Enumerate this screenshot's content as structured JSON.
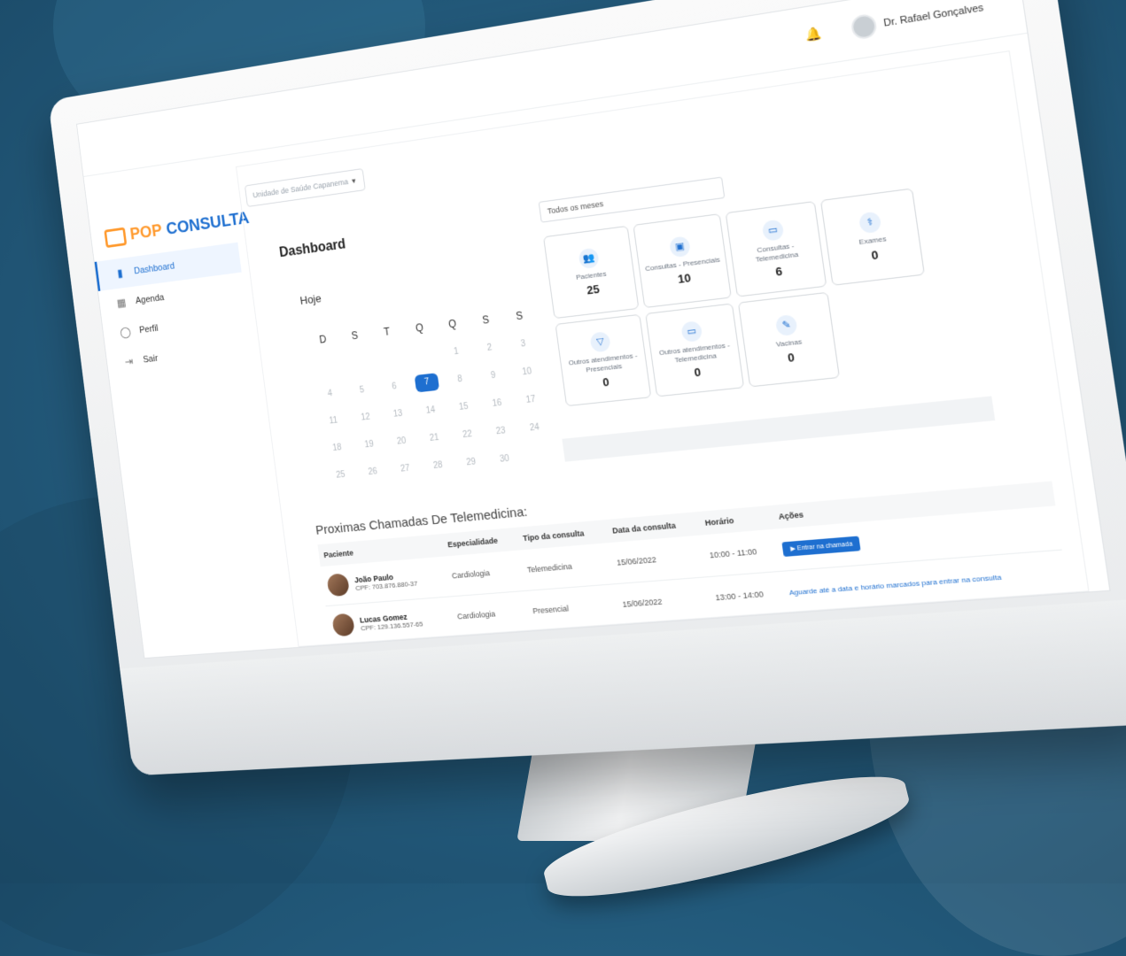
{
  "topbar": {
    "unit_placeholder": "Unidade de Saúde Capanema",
    "user_name": "Dr. Rafael Gonçalves"
  },
  "brand": {
    "pop": "POP",
    "consulta": "CONSULTA"
  },
  "sidebar": {
    "items": [
      {
        "label": "Dashboard",
        "icon": "bar-chart-icon",
        "active": true
      },
      {
        "label": "Agenda",
        "icon": "calendar-icon",
        "active": false
      },
      {
        "label": "Perfil",
        "icon": "user-icon",
        "active": false
      },
      {
        "label": "Sair",
        "icon": "logout-icon",
        "active": false
      }
    ]
  },
  "main": {
    "title": "Dashboard",
    "today_label": "Hoje",
    "month_select": "Todos os meses"
  },
  "calendar": {
    "headers": [
      "D",
      "S",
      "T",
      "Q",
      "Q",
      "S",
      "S"
    ],
    "weeks": [
      [
        "",
        "",
        "",
        "",
        "1",
        "2",
        "3"
      ],
      [
        "4",
        "5",
        "6",
        "7",
        "8",
        "9",
        "10"
      ],
      [
        "11",
        "12",
        "13",
        "14",
        "15",
        "16",
        "17"
      ],
      [
        "18",
        "19",
        "20",
        "21",
        "22",
        "23",
        "24"
      ],
      [
        "25",
        "26",
        "27",
        "28",
        "29",
        "30",
        ""
      ]
    ],
    "selected": "7"
  },
  "stats": [
    {
      "label": "Pacientes",
      "value": "25",
      "icon": "users-icon"
    },
    {
      "label": "Consultas - Presenciais",
      "value": "10",
      "icon": "clipboard-icon"
    },
    {
      "label": "Consultas - Telemedicina",
      "value": "6",
      "icon": "monitor-icon"
    },
    {
      "label": "Exames",
      "value": "0",
      "icon": "stethoscope-icon"
    },
    {
      "label": "Outros atendimentos - Presenciais",
      "value": "0",
      "icon": "tooth-icon"
    },
    {
      "label": "Outros atendimentos - Telemedicina",
      "value": "0",
      "icon": "laptop-icon"
    },
    {
      "label": "Vacinas",
      "value": "0",
      "icon": "syringe-icon"
    }
  ],
  "table": {
    "title": "Proximas Chamadas De Telemedicina:",
    "columns": [
      "Paciente",
      "Especialidade",
      "Tipo da consulta",
      "Data da consulta",
      "Horário",
      "Ações"
    ],
    "rows": [
      {
        "name": "João Paulo",
        "cpf": "CPF: 703.876.880-37",
        "especialidade": "Cardiologia",
        "tipo": "Telemedicina",
        "data": "15/06/2022",
        "horario": "10:00 - 11:00",
        "acao": "Entrar na chamada",
        "acao_type": "button"
      },
      {
        "name": "Lucas Gomez",
        "cpf": "CPF: 129.136.557-65",
        "especialidade": "Cardiologia",
        "tipo": "Presencial",
        "data": "15/06/2022",
        "horario": "13:00 - 14:00",
        "acao": "Aguarde até a data e horário marcados para entrar na consulta",
        "acao_type": "text"
      }
    ]
  }
}
